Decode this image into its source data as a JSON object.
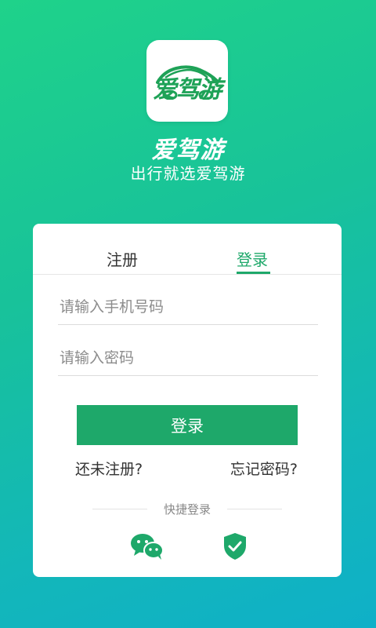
{
  "header": {
    "logo_text": "爱驾游",
    "app_name": "爱驾游",
    "slogan": "出行就选爱驾游"
  },
  "tabs": [
    {
      "label": "注册",
      "active": false
    },
    {
      "label": "登录",
      "active": true
    }
  ],
  "form": {
    "phone_placeholder": "请输入手机号码",
    "password_placeholder": "请输入密码",
    "submit_label": "登录"
  },
  "links": {
    "register": "还未注册?",
    "forgot": "忘记密码?"
  },
  "quick_login": {
    "label": "快捷登录",
    "icons": [
      "wechat-icon",
      "shield-check-icon"
    ]
  },
  "colors": {
    "accent": "#1ea86a",
    "gradient_start": "#1fd28a",
    "gradient_end": "#0fb0c8"
  }
}
